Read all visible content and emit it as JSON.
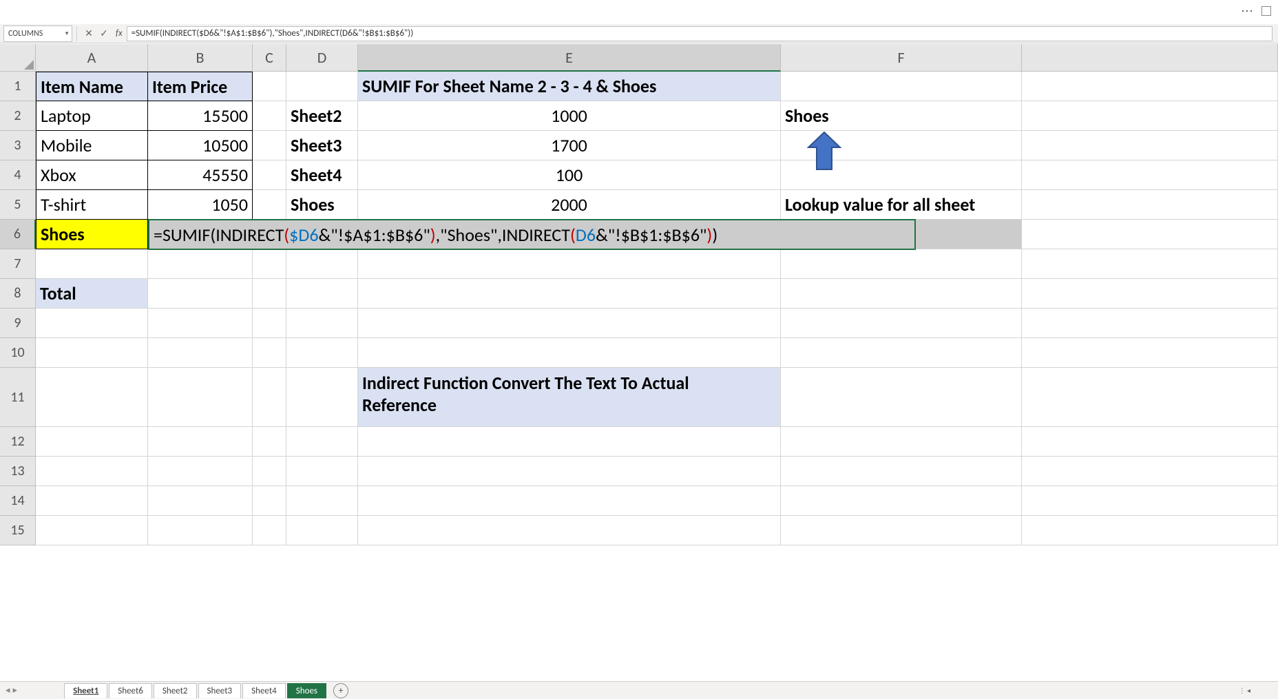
{
  "top": {
    "name_box": "COLUMNS",
    "formula": "=SUMIF(INDIRECT($D6&\"!$A$1:$B$6\"),\"Shoes\",INDIRECT(D6&\"!$B$1:$B$6\"))"
  },
  "cols": [
    "A",
    "B",
    "C",
    "D",
    "E",
    "F"
  ],
  "rows": [
    "1",
    "2",
    "3",
    "4",
    "5",
    "6",
    "7",
    "8",
    "9",
    "10",
    "11",
    "12",
    "13",
    "14",
    "15"
  ],
  "cells": {
    "A1": "Item Name",
    "B1": "Item Price",
    "A2": "Laptop",
    "B2": "15500",
    "A3": "Mobile",
    "B3": "10500",
    "A4": "Xbox",
    "B4": "45550",
    "A5": "T-shirt",
    "B5": "1050",
    "A6": "Shoes",
    "A8": "Total",
    "D2": "Sheet2",
    "E2": "1000",
    "D3": "Sheet3",
    "E3": "1700",
    "D4": "Sheet4",
    "E4": "100",
    "D5": "Shoes",
    "E5": "2000",
    "E1": "SUMIF For Sheet Name 2 - 3 - 4 & Shoes",
    "F2": "Shoes",
    "F5": "Lookup value for all sheet",
    "E11a": "Indirect Function Convert The Text To Actual",
    "E11b": "Reference"
  },
  "formula_parts": {
    "p1": "=SUMIF",
    "p2": "(",
    "p3": "INDIRECT",
    "p4": "(",
    "p5": "$D6",
    "p6": "&\"!$A$1:$B$6\"",
    "p7": ")",
    "p8": ",\"Shoes\",",
    "p9": "INDIRECT",
    "p10": "(",
    "p11": "D6",
    "p12": "&\"!$B$1:$B$6\"",
    "p13": ")",
    "p14": ")"
  },
  "tabs": {
    "t1": "Sheet1",
    "t2": "Sheet6",
    "t3": "Sheet2",
    "t4": "Sheet3",
    "t5": "Sheet4",
    "t6": "Shoes",
    "add": "+"
  },
  "fx": "fx",
  "cancel": "✕",
  "confirm": "✓",
  "dots": "⋯"
}
